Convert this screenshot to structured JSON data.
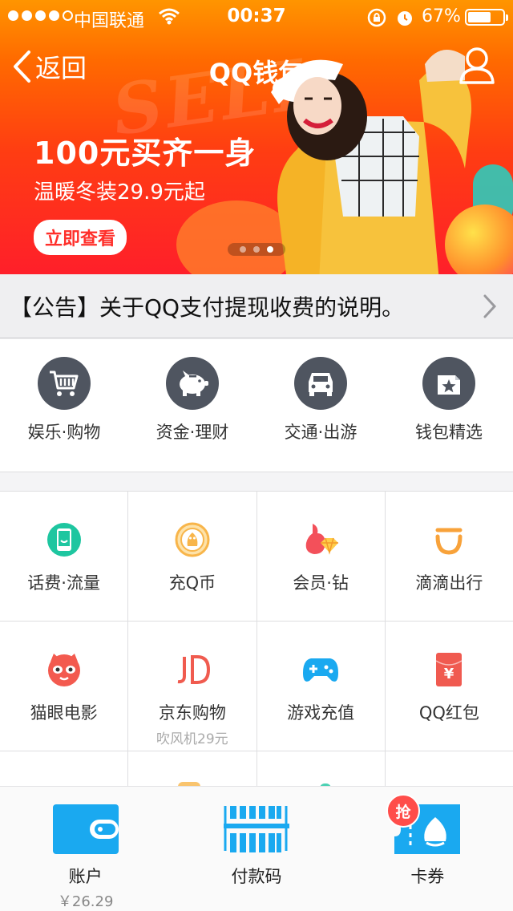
{
  "status_bar": {
    "carrier": "中国联通",
    "time": "00:37",
    "battery_pct": "67%",
    "battery_level": 0.67
  },
  "nav": {
    "back_label": "返回",
    "title": "QQ钱包"
  },
  "banner": {
    "watermark": "SELL",
    "headline": "100元买齐一身",
    "subline": "温暖冬装29.9元起",
    "cta": "立即查看",
    "page_count": 3,
    "active_page": 3
  },
  "notice": {
    "text": "【公告】关于QQ支付提现收费的说明。"
  },
  "categories": [
    {
      "label": "娱乐·购物",
      "icon": "cart-icon"
    },
    {
      "label": "资金·理财",
      "icon": "piggy-bank-icon"
    },
    {
      "label": "交通·出游",
      "icon": "car-icon"
    },
    {
      "label": "钱包精选",
      "icon": "star-bag-icon"
    }
  ],
  "services": [
    [
      {
        "label": "话费·流量",
        "sub": "",
        "icon": "phone-icon",
        "color": "#1ec6a0"
      },
      {
        "label": "充Q币",
        "sub": "",
        "icon": "qcoin-icon",
        "color": "#f8b54a"
      },
      {
        "label": "会员·钻",
        "sub": "",
        "icon": "vip-diamond-icon",
        "color": "#f3505a"
      },
      {
        "label": "滴滴出行",
        "sub": "",
        "icon": "didi-icon",
        "color": "#f8a23a"
      }
    ],
    [
      {
        "label": "猫眼电影",
        "sub": "",
        "icon": "maoyan-cat-icon",
        "color": "#f35a4f"
      },
      {
        "label": "京东购物",
        "sub": "吹风机29元",
        "icon": "jd-icon",
        "color": "#f05b4f"
      },
      {
        "label": "游戏充值",
        "sub": "",
        "icon": "gamepad-icon",
        "color": "#1aa9f0"
      },
      {
        "label": "QQ红包",
        "sub": "",
        "icon": "red-envelope-icon",
        "color": "#f05a50"
      }
    ]
  ],
  "tabs": [
    {
      "label": "账户",
      "sub": "￥26.29",
      "icon": "wallet-icon"
    },
    {
      "label": "付款码",
      "sub": "",
      "icon": "barcode-icon"
    },
    {
      "label": "卡券",
      "sub": "",
      "icon": "ticket-icon"
    }
  ],
  "tab_badge": "抢",
  "colors": {
    "accent_blue": "#1aa9f0",
    "banner_orange": "#ff6a00",
    "banner_red": "#ff1f2a",
    "icon_gray": "#4f5560"
  }
}
